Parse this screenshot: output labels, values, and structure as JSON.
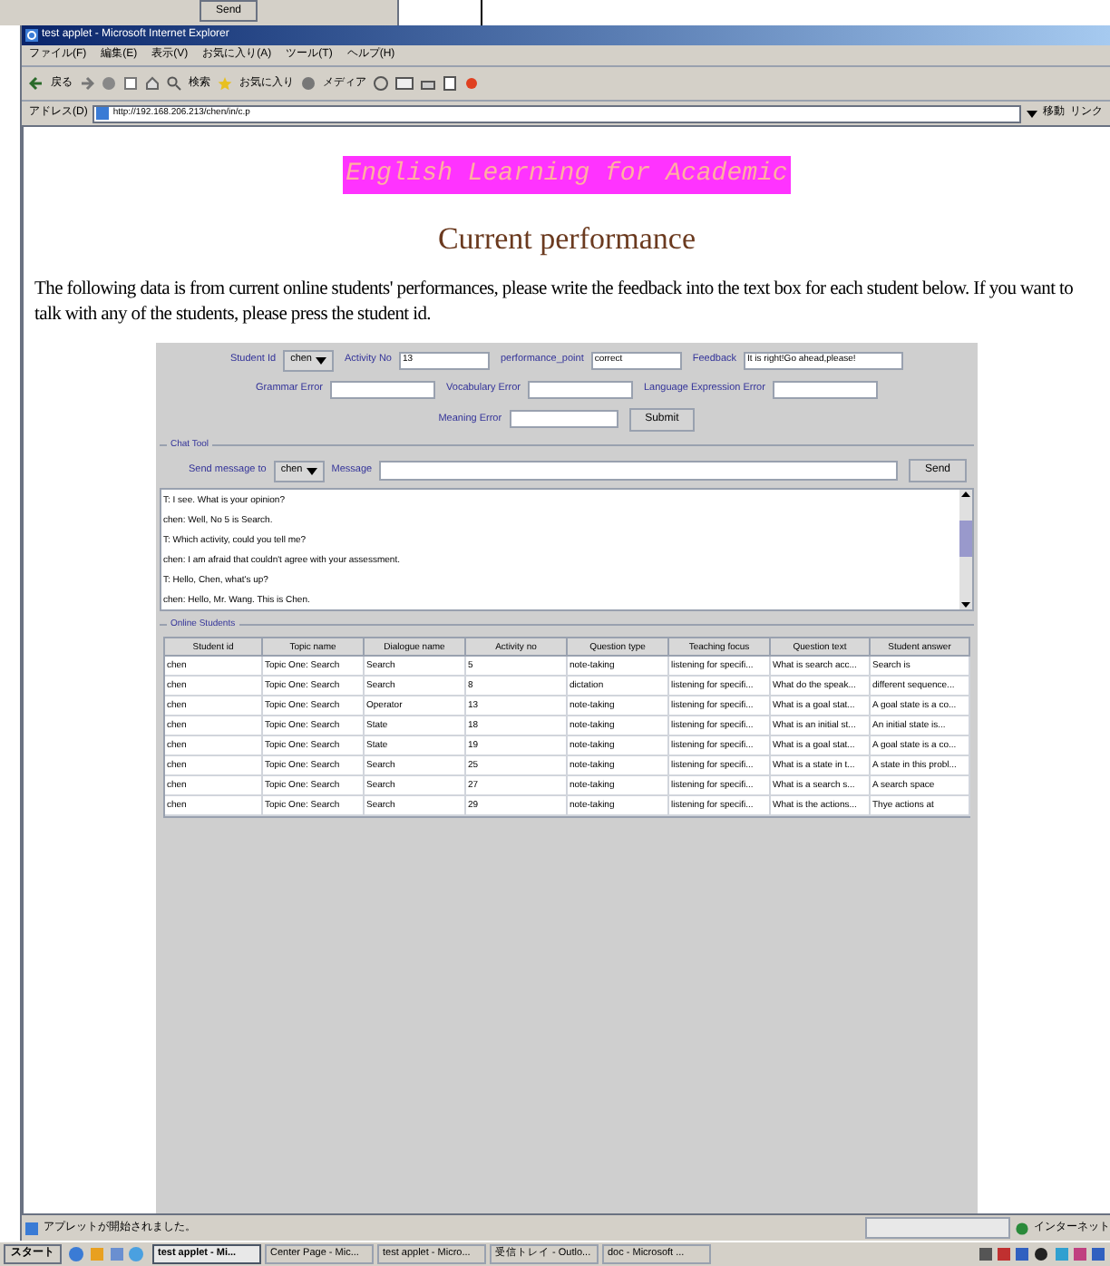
{
  "background_window": {
    "button": "Send"
  },
  "window": {
    "title": "test applet - Microsoft Internet Explorer"
  },
  "menu": [
    "ファイル(F)",
    "編集(E)",
    "表示(V)",
    "お気に入り(A)",
    "ツール(T)",
    "ヘルプ(H)"
  ],
  "toolbar": {
    "back": "戻る",
    "search": "検索",
    "favorites": "お気に入り",
    "media": "メディア"
  },
  "address_bar": {
    "label": "アドレス(D)",
    "url": "http://192.168.206.213/chen/in/c.p",
    "go": "移動",
    "links": "リンク"
  },
  "page": {
    "banner": "English Learning for Academic",
    "heading": "Current performance",
    "intro": "The following data is from current online students' performances, please write the feedback into the text box for each student below. If you want to talk with any of the students, please press the student id."
  },
  "form": {
    "row_1": [
      {
        "kind": "select",
        "label": "Student Id",
        "value": "chen"
      },
      {
        "kind": "text",
        "label": "Activity No",
        "value": "13"
      },
      {
        "kind": "text",
        "label": "performance_point",
        "value": "correct"
      },
      {
        "kind": "text",
        "label": "Feedback",
        "value": "It is right!Go ahead,please!"
      }
    ],
    "row_2": [
      {
        "kind": "text",
        "label": "Grammar Error"
      },
      {
        "kind": "text",
        "label": "Vocabulary Error"
      },
      {
        "kind": "text",
        "label": "Language Expression Error"
      }
    ],
    "row_3": [
      {
        "kind": "text",
        "label": "Meaning Error"
      },
      {
        "kind": "button",
        "label": "Submit"
      }
    ]
  },
  "chat": {
    "legend": "Chat Tool",
    "to_label": "Send message to",
    "to_value": "chen",
    "message_label": "Message",
    "send": "Send",
    "lines": [
      "T: I see. What is your opinion?",
      "chen: Well, No 5 is Search.",
      "T: Which activity, could you tell me?",
      "chen: I am afraid that couldn't agree with your assessment.",
      "T: Hello, Chen, what's up?",
      "chen: Hello, Mr. Wang. This is Chen."
    ]
  },
  "online_students": {
    "legend": "Online Students",
    "columns": [
      "Student id",
      "Topic name",
      "Dialogue name",
      "Activity no",
      "Question type",
      "Teaching focus",
      "Question text",
      "Student answer"
    ],
    "rows": [
      [
        "chen",
        "Topic One:  Search",
        "Search",
        "5",
        "note-taking",
        "listening for specifi...",
        "What is search acc...",
        "Search is"
      ],
      [
        "chen",
        "Topic One:  Search",
        "Search",
        "8",
        "dictation",
        "listening for specifi...",
        "What do the speak...",
        "different sequence..."
      ],
      [
        "chen",
        "Topic One:  Search",
        "Operator",
        "13",
        "note-taking",
        "listening for specifi...",
        "What is a goal stat...",
        "A goal state is a co..."
      ],
      [
        "chen",
        "Topic One:  Search",
        "State",
        "18",
        "note-taking",
        "listening for specifi...",
        "What is an initial st...",
        "An initial state is..."
      ],
      [
        "chen",
        "Topic One:  Search",
        "State",
        "19",
        "note-taking",
        "listening for specifi...",
        "What is a goal stat...",
        "A goal state is a co..."
      ],
      [
        "chen",
        "Topic One:  Search",
        "Search",
        "25",
        "note-taking",
        "listening for specifi...",
        "What is a state in t...",
        "A state in this probl..."
      ],
      [
        "chen",
        "Topic One:  Search",
        "Search",
        "27",
        "note-taking",
        "listening for specifi...",
        "What is a search s...",
        "A search space"
      ],
      [
        "chen",
        "Topic One:  Search",
        "Search",
        "29",
        "note-taking",
        "listening for specifi...",
        "What is the actions...",
        "Thye actions at"
      ]
    ]
  },
  "status_bar": {
    "message": "アプレットが開始されました。",
    "zone": "インターネット"
  },
  "taskbar": {
    "start": "スタート",
    "tasks": [
      {
        "label": "test applet - Mi...",
        "selected": true
      },
      {
        "label": "Center Page - Mic...",
        "selected": false
      },
      {
        "label": "test applet - Micro...",
        "selected": false
      },
      {
        "label": "受信トレイ - Outlo...",
        "selected": false
      },
      {
        "label": "doc - Microsoft ...",
        "selected": false
      }
    ]
  }
}
